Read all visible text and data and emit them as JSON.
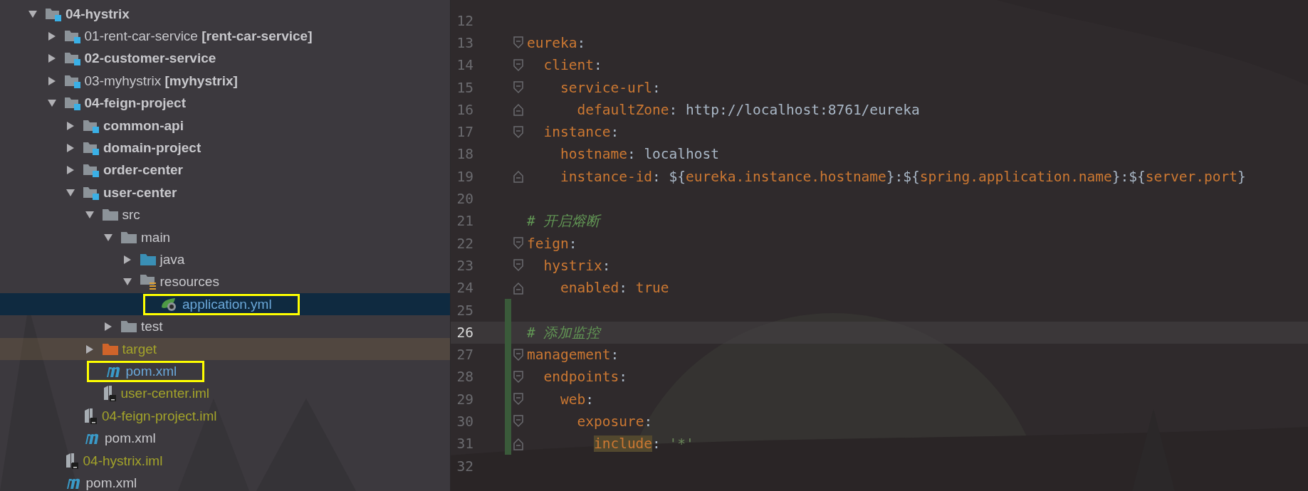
{
  "project_tree": {
    "items": [
      {
        "label": "04-hystrix",
        "kind": "module",
        "bold": true,
        "expanded": true,
        "children": [
          {
            "label": "01-rent-car-service **[rent-car-service]**",
            "kind": "module",
            "bold": false,
            "expanded": false
          },
          {
            "label": "02-customer-service",
            "kind": "module",
            "bold": true,
            "expanded": false
          },
          {
            "label": "03-myhystrix **[myhystrix]**",
            "kind": "module",
            "bold": false,
            "expanded": false
          },
          {
            "label": "04-feign-project",
            "kind": "module",
            "bold": true,
            "expanded": true,
            "children": [
              {
                "label": "common-api",
                "kind": "module",
                "bold": true,
                "expanded": false
              },
              {
                "label": "domain-project",
                "kind": "module",
                "bold": true,
                "expanded": false
              },
              {
                "label": "order-center",
                "kind": "module",
                "bold": true,
                "expanded": false
              },
              {
                "label": "user-center",
                "kind": "module",
                "bold": true,
                "expanded": true,
                "children": [
                  {
                    "label": "src",
                    "kind": "folder",
                    "expanded": true,
                    "children": [
                      {
                        "label": "main",
                        "kind": "folder",
                        "expanded": true,
                        "children": [
                          {
                            "label": "java",
                            "kind": "source-folder",
                            "expanded": false
                          },
                          {
                            "label": "resources",
                            "kind": "resources-folder",
                            "expanded": true,
                            "children": [
                              {
                                "label": "application.yml",
                                "kind": "yml",
                                "selected": true,
                                "modified": true,
                                "annotated": true
                              }
                            ]
                          }
                        ]
                      },
                      {
                        "label": "test",
                        "kind": "folder",
                        "expanded": false
                      }
                    ]
                  },
                  {
                    "label": "target",
                    "kind": "excluded-folder",
                    "expanded": false,
                    "excluded": true
                  },
                  {
                    "label": "pom.xml",
                    "kind": "maven",
                    "modified": true,
                    "annotated": true
                  },
                  {
                    "label": "user-center.iml",
                    "kind": "iml",
                    "excluded": true
                  }
                ]
              },
              {
                "label": "04-feign-project.iml",
                "kind": "iml",
                "excluded": true
              },
              {
                "label": "pom.xml",
                "kind": "maven"
              }
            ]
          },
          {
            "label": "04-hystrix.iml",
            "kind": "iml",
            "excluded": true
          },
          {
            "label": "pom.xml",
            "kind": "maven"
          }
        ]
      }
    ]
  },
  "editor": {
    "lines": [
      {
        "number": "12"
      },
      {
        "number": "13",
        "fold_start": true,
        "tokens": [
          {
            "kind": "key",
            "text": "eureka"
          },
          {
            "kind": "punct",
            "text": ":"
          }
        ]
      },
      {
        "number": "14",
        "fold_start": true,
        "tokens": [
          {
            "kind": "key",
            "text": "  client"
          },
          {
            "kind": "punct",
            "text": ":"
          }
        ]
      },
      {
        "number": "15",
        "fold_start": true,
        "tokens": [
          {
            "kind": "key",
            "text": "    service-url"
          },
          {
            "kind": "punct",
            "text": ":"
          }
        ]
      },
      {
        "number": "16",
        "fold_end": true,
        "tokens": [
          {
            "kind": "key",
            "text": "      defaultZone"
          },
          {
            "kind": "punct",
            "text": ": "
          },
          {
            "kind": "plain",
            "text": "http://localhost:8761/eureka"
          }
        ]
      },
      {
        "number": "17",
        "fold_start": true,
        "tokens": [
          {
            "kind": "key",
            "text": "  instance"
          },
          {
            "kind": "punct",
            "text": ":"
          }
        ]
      },
      {
        "number": "18",
        "tokens": [
          {
            "kind": "key",
            "text": "    hostname"
          },
          {
            "kind": "punct",
            "text": ": "
          },
          {
            "kind": "plain",
            "text": "localhost"
          }
        ]
      },
      {
        "number": "19",
        "fold_end": true,
        "tokens": [
          {
            "kind": "key",
            "text": "    instance-id"
          },
          {
            "kind": "punct",
            "text": ": ${"
          },
          {
            "kind": "var",
            "text": "eureka.instance.hostname"
          },
          {
            "kind": "punct",
            "text": "}:${"
          },
          {
            "kind": "var",
            "text": "spring.application.name"
          },
          {
            "kind": "punct",
            "text": "}:${"
          },
          {
            "kind": "var",
            "text": "server.port"
          },
          {
            "kind": "punct",
            "text": "}"
          }
        ]
      },
      {
        "number": "20"
      },
      {
        "number": "21",
        "tokens": [
          {
            "kind": "comment",
            "text": "# 开启熔断"
          }
        ]
      },
      {
        "number": "22",
        "fold_start": true,
        "tokens": [
          {
            "kind": "key",
            "text": "feign"
          },
          {
            "kind": "punct",
            "text": ":"
          }
        ]
      },
      {
        "number": "23",
        "fold_start": true,
        "tokens": [
          {
            "kind": "key",
            "text": "  hystrix"
          },
          {
            "kind": "punct",
            "text": ":"
          }
        ]
      },
      {
        "number": "24",
        "fold_end": true,
        "tokens": [
          {
            "kind": "key",
            "text": "    enabled"
          },
          {
            "kind": "punct",
            "text": ": "
          },
          {
            "kind": "keyword",
            "text": "true"
          }
        ]
      },
      {
        "number": "25",
        "changed": true
      },
      {
        "number": "26",
        "changed": true,
        "selected": true,
        "tokens": [
          {
            "kind": "comment",
            "text": "# 添加监控"
          }
        ]
      },
      {
        "number": "27",
        "changed": true,
        "fold_start": true,
        "tokens": [
          {
            "kind": "key",
            "text": "management"
          },
          {
            "kind": "punct",
            "text": ":"
          }
        ]
      },
      {
        "number": "28",
        "changed": true,
        "fold_start": true,
        "tokens": [
          {
            "kind": "key",
            "text": "  endpoints"
          },
          {
            "kind": "punct",
            "text": ":"
          }
        ]
      },
      {
        "number": "29",
        "changed": true,
        "fold_start": true,
        "tokens": [
          {
            "kind": "key",
            "text": "    web"
          },
          {
            "kind": "punct",
            "text": ":"
          }
        ]
      },
      {
        "number": "30",
        "changed": true,
        "fold_start": true,
        "tokens": [
          {
            "kind": "key",
            "text": "      exposure"
          },
          {
            "kind": "punct",
            "text": ":"
          }
        ]
      },
      {
        "number": "31",
        "changed": true,
        "fold_end": true,
        "tokens": [
          {
            "kind": "key",
            "text": "        include",
            "highlighted": true
          },
          {
            "kind": "punct",
            "text": ": "
          },
          {
            "kind": "string",
            "text": "'*'"
          }
        ]
      },
      {
        "number": "32"
      }
    ]
  }
}
